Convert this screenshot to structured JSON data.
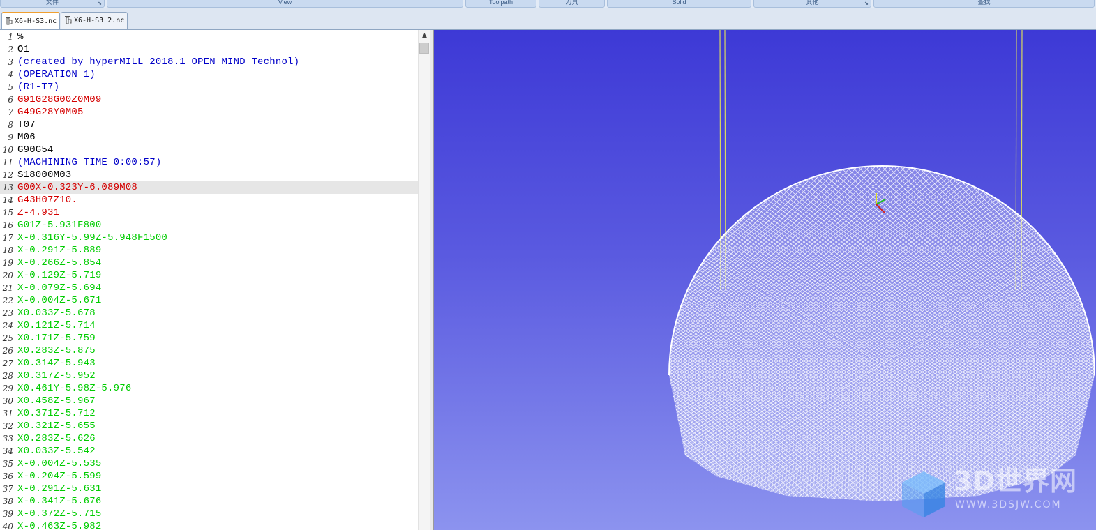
{
  "ribbon": {
    "groups": [
      "文件",
      "View",
      "Toolpath",
      "刀具",
      "Solid",
      "其他",
      "查找"
    ]
  },
  "tabs": [
    {
      "label": "X6-H-S3.nc",
      "active": true
    },
    {
      "label": "X6-H-S3_2.nc",
      "active": false
    }
  ],
  "colors": {
    "black": "#000000",
    "blue": "#0000c8",
    "red": "#d40000",
    "green": "#00cc00",
    "viewport_top": "#3d39d6",
    "viewport_bottom": "#8c93ef",
    "highlight_line": "#e6e6e6"
  },
  "editor": {
    "highlighted_line": 13,
    "lines": [
      {
        "n": "1",
        "text": "%",
        "color": "black"
      },
      {
        "n": "2",
        "text": "O1",
        "color": "black"
      },
      {
        "n": "3",
        "text": "(created by hyperMILL 2018.1 OPEN MIND Technol)",
        "color": "blue"
      },
      {
        "n": "4",
        "text": "(OPERATION 1)",
        "color": "blue"
      },
      {
        "n": "5",
        "text": "(R1-T7)",
        "color": "blue"
      },
      {
        "n": "6",
        "text": "G91G28G00Z0M09",
        "color": "red"
      },
      {
        "n": "7",
        "text": "G49G28Y0M05",
        "color": "red"
      },
      {
        "n": "8",
        "text": "T07",
        "color": "black"
      },
      {
        "n": "9",
        "text": "M06",
        "color": "black"
      },
      {
        "n": "10",
        "text": "G90G54",
        "color": "black"
      },
      {
        "n": "11",
        "text": "(MACHINING TIME 0:00:57)",
        "color": "blue"
      },
      {
        "n": "12",
        "text": "S18000M03",
        "color": "black"
      },
      {
        "n": "13",
        "text": "G00X-0.323Y-6.089M08",
        "color": "red"
      },
      {
        "n": "14",
        "text": "G43H07Z10.",
        "color": "red"
      },
      {
        "n": "15",
        "text": "Z-4.931",
        "color": "red"
      },
      {
        "n": "16",
        "text": "G01Z-5.931F800",
        "color": "green"
      },
      {
        "n": "17",
        "text": "X-0.316Y-5.99Z-5.948F1500",
        "color": "green"
      },
      {
        "n": "18",
        "text": "X-0.291Z-5.889",
        "color": "green"
      },
      {
        "n": "19",
        "text": "X-0.266Z-5.854",
        "color": "green"
      },
      {
        "n": "20",
        "text": "X-0.129Z-5.719",
        "color": "green"
      },
      {
        "n": "21",
        "text": "X-0.079Z-5.694",
        "color": "green"
      },
      {
        "n": "22",
        "text": "X-0.004Z-5.671",
        "color": "green"
      },
      {
        "n": "23",
        "text": "X0.033Z-5.678",
        "color": "green"
      },
      {
        "n": "24",
        "text": "X0.121Z-5.714",
        "color": "green"
      },
      {
        "n": "25",
        "text": "X0.171Z-5.759",
        "color": "green"
      },
      {
        "n": "26",
        "text": "X0.283Z-5.875",
        "color": "green"
      },
      {
        "n": "27",
        "text": "X0.314Z-5.943",
        "color": "green"
      },
      {
        "n": "28",
        "text": "X0.317Z-5.952",
        "color": "green"
      },
      {
        "n": "29",
        "text": "X0.461Y-5.98Z-5.976",
        "color": "green"
      },
      {
        "n": "30",
        "text": "X0.458Z-5.967",
        "color": "green"
      },
      {
        "n": "31",
        "text": "X0.371Z-5.712",
        "color": "green"
      },
      {
        "n": "32",
        "text": "X0.321Z-5.655",
        "color": "green"
      },
      {
        "n": "33",
        "text": "X0.283Z-5.626",
        "color": "green"
      },
      {
        "n": "34",
        "text": "X0.033Z-5.542",
        "color": "green"
      },
      {
        "n": "35",
        "text": "X-0.004Z-5.535",
        "color": "green"
      },
      {
        "n": "36",
        "text": "X-0.204Z-5.599",
        "color": "green"
      },
      {
        "n": "37",
        "text": "X-0.291Z-5.631",
        "color": "green"
      },
      {
        "n": "38",
        "text": "X-0.341Z-5.676",
        "color": "green"
      },
      {
        "n": "39",
        "text": "X-0.372Z-5.715",
        "color": "green"
      },
      {
        "n": "40",
        "text": "X-0.463Z-5.982",
        "color": "green"
      }
    ]
  },
  "watermark": {
    "brand": "3D世界网",
    "url": "WWW.3DSJW.COM"
  }
}
